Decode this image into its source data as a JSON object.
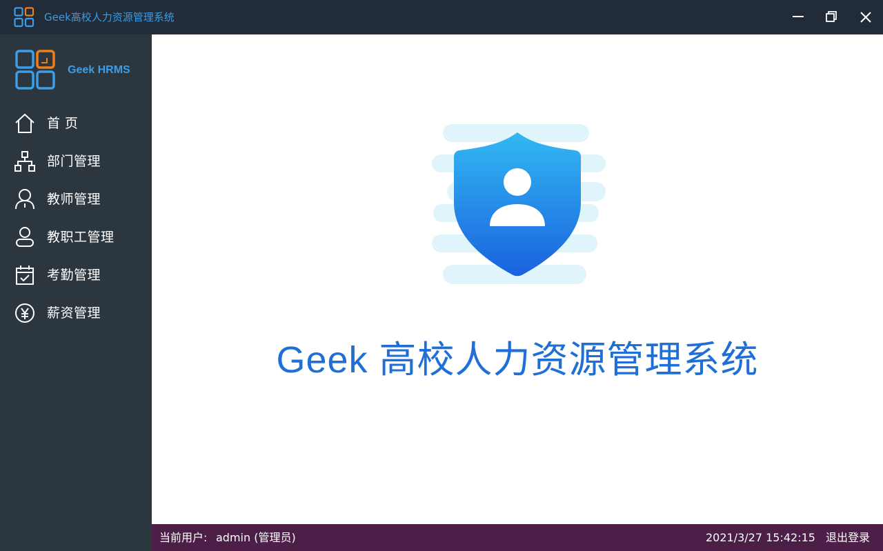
{
  "window": {
    "title": "Geek高校人力资源管理系统",
    "controls": {
      "minimize": "minimize-icon",
      "restore": "restore-icon",
      "close": "close-icon"
    }
  },
  "sidebar": {
    "brand": "Geek HRMS",
    "items": [
      {
        "label": "首 页",
        "icon": "home-icon"
      },
      {
        "label": "部门管理",
        "icon": "org-chart-icon"
      },
      {
        "label": "教师管理",
        "icon": "teacher-icon"
      },
      {
        "label": "教职工管理",
        "icon": "staff-icon"
      },
      {
        "label": "考勤管理",
        "icon": "calendar-check-icon"
      },
      {
        "label": "薪资管理",
        "icon": "yuan-icon"
      }
    ]
  },
  "main": {
    "system_title": "Geek 高校人力资源管理系统",
    "hero_icon": "shield-user-icon"
  },
  "status": {
    "user_label": "当前用户:",
    "user_value": "admin (管理员)",
    "datetime": "2021/3/27 15:42:15",
    "logout": "退出登录"
  },
  "colors": {
    "titlebar_bg": "#222b38",
    "sidebar_bg": "#2c363f",
    "accent_blue": "#3b9ee6",
    "accent_orange": "#f07d1a",
    "title_text": "#1f6fd6",
    "statusbar_bg": "#4d1e47"
  }
}
